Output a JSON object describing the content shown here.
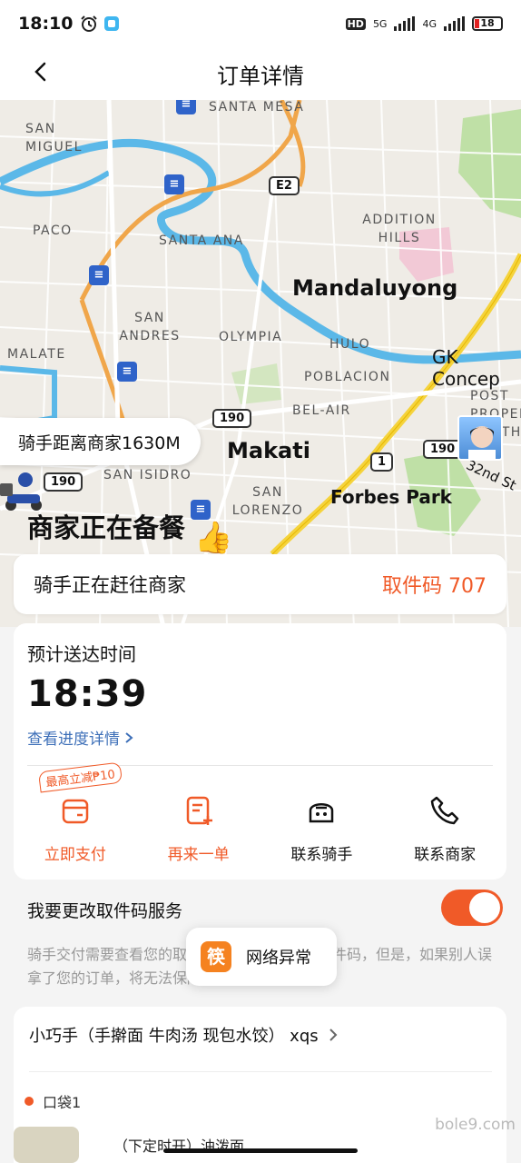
{
  "status_bar": {
    "time": "18:10",
    "network_1": "5G",
    "network_2": "4G",
    "hd": "HD",
    "battery": "18"
  },
  "nav": {
    "back_icon": "chevron-left-icon",
    "title": "订单详情"
  },
  "map": {
    "labels": {
      "santa_mesa": "SANTA MESA",
      "san_miguel": "SAN MIGUEL",
      "paco": "PACO",
      "santa_ana": "SANTA ANA",
      "addition_hills": "ADDITION HILLS",
      "mandaluyong": "Mandaluyong",
      "san_andres": "SAN ANDRES",
      "malate": "MALATE",
      "olympia": "OLYMPIA",
      "hulo": "HULO",
      "poblacion": "POBLACION",
      "bel_air": "BEL-AIR",
      "post_proper": "POST PROPER NORTH",
      "gk": "GK Concep",
      "makati": "Makati",
      "san_isidro": "SAN ISIDRO",
      "san_lorenzo": "SAN LORENZO",
      "forbes_park": "Forbes Park",
      "street_32nd": "32nd St"
    },
    "shields": {
      "e2": "E2",
      "r190a": "190",
      "r190b": "190",
      "r190c": "190",
      "r190d": "190",
      "r1": "1"
    },
    "distance_text": "骑手距离商家1630M",
    "merchant_status": "商家正在备餐"
  },
  "heading_card": {
    "text": "骑手正在赶往商家",
    "pickup_code": "取件码 707"
  },
  "order_card": {
    "eta_label": "预计送达时间",
    "eta_time": "18:39",
    "progress_link": "查看进度详情",
    "promo_tag": "最高立减₱10",
    "actions": [
      {
        "label": "立即支付",
        "icon": "wallet-icon"
      },
      {
        "label": "再来一单",
        "icon": "reorder-icon"
      },
      {
        "label": "联系骑手",
        "icon": "rider-helmet-icon"
      },
      {
        "label": "联系商家",
        "icon": "phone-icon"
      }
    ]
  },
  "change_code": {
    "title": "我要更改取件码服务",
    "description": "骑手交付需要查看您的取件码，您也可以取消取件码，但是，如果别人误拿了您的订单，将无法保障您的权益",
    "enabled": true
  },
  "toast": {
    "logo_char": "筷",
    "text": "网络异常"
  },
  "store": {
    "name": "小巧手（手擀面 牛肉汤 现包水饺） xqs",
    "bag_label": "口袋1",
    "item_text": "（下定时开）油泼面"
  },
  "watermark": "bole9.com",
  "colors": {
    "accent": "#f05a28",
    "link": "#3d6fb8",
    "river": "#5bb8e8",
    "road_major": "#f0a64a",
    "road_yellow": "#f5d33c"
  }
}
